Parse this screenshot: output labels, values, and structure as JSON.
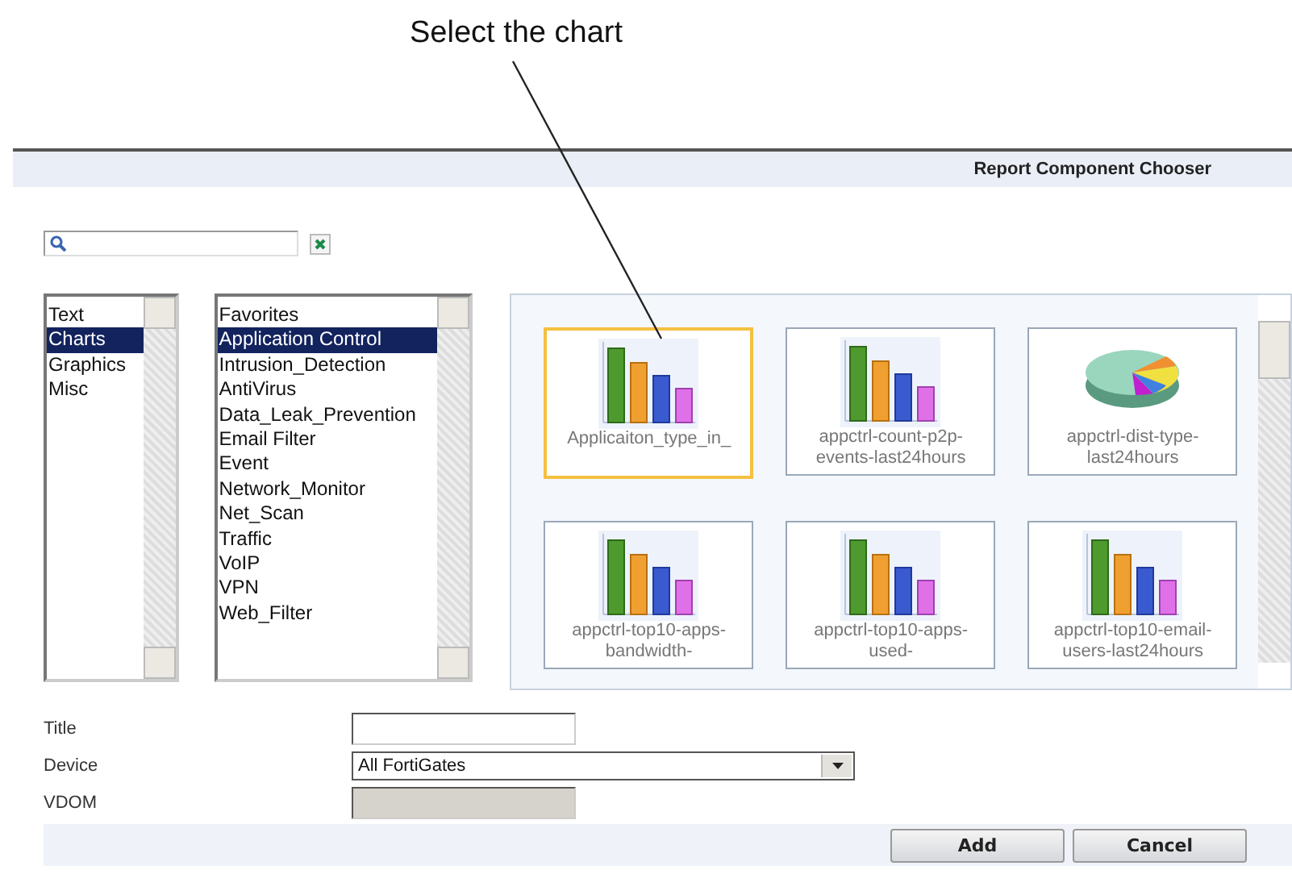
{
  "callout": {
    "text": "Select the chart"
  },
  "window": {
    "title": "Report Component Chooser"
  },
  "categories": [
    {
      "label": "Text",
      "selected": false
    },
    {
      "label": "Charts",
      "selected": true
    },
    {
      "label": "Graphics",
      "selected": false
    },
    {
      "label": "Misc",
      "selected": false
    }
  ],
  "folders": [
    {
      "label": "Favorites",
      "selected": false
    },
    {
      "label": "Application Control",
      "selected": true
    },
    {
      "label": "Intrusion_Detection",
      "selected": false
    },
    {
      "label": "AntiVirus",
      "selected": false
    },
    {
      "label": "Data_Leak_Prevention",
      "selected": false
    },
    {
      "label": "Email Filter",
      "selected": false
    },
    {
      "label": "Event",
      "selected": false
    },
    {
      "label": "Network_Monitor",
      "selected": false
    },
    {
      "label": "Net_Scan",
      "selected": false
    },
    {
      "label": "Traffic",
      "selected": false
    },
    {
      "label": "VoIP",
      "selected": false
    },
    {
      "label": "VPN",
      "selected": false
    },
    {
      "label": "Web_Filter",
      "selected": false
    }
  ],
  "charts": [
    {
      "kind": "bar",
      "label": "Applicaiton_type_in_",
      "selected": true
    },
    {
      "kind": "bar",
      "label": "appctrl-count-p2p-events-last24hours",
      "selected": false
    },
    {
      "kind": "pie",
      "label": "appctrl-dist-type-last24hours",
      "selected": false
    },
    {
      "kind": "bar",
      "label": "appctrl-top10-apps-bandwidth-",
      "selected": false
    },
    {
      "kind": "bar",
      "label": "appctrl-top10-apps-used-",
      "selected": false
    },
    {
      "kind": "bar",
      "label": "appctrl-top10-email-users-last24hours",
      "selected": false
    }
  ],
  "form": [
    {
      "kind": "text",
      "label": "Title"
    },
    {
      "kind": "select",
      "label": "Device",
      "value": "All FortiGates"
    },
    {
      "kind": "disabled",
      "label": "VDOM"
    }
  ],
  "buttons": [
    "Add",
    "Cancel"
  ]
}
